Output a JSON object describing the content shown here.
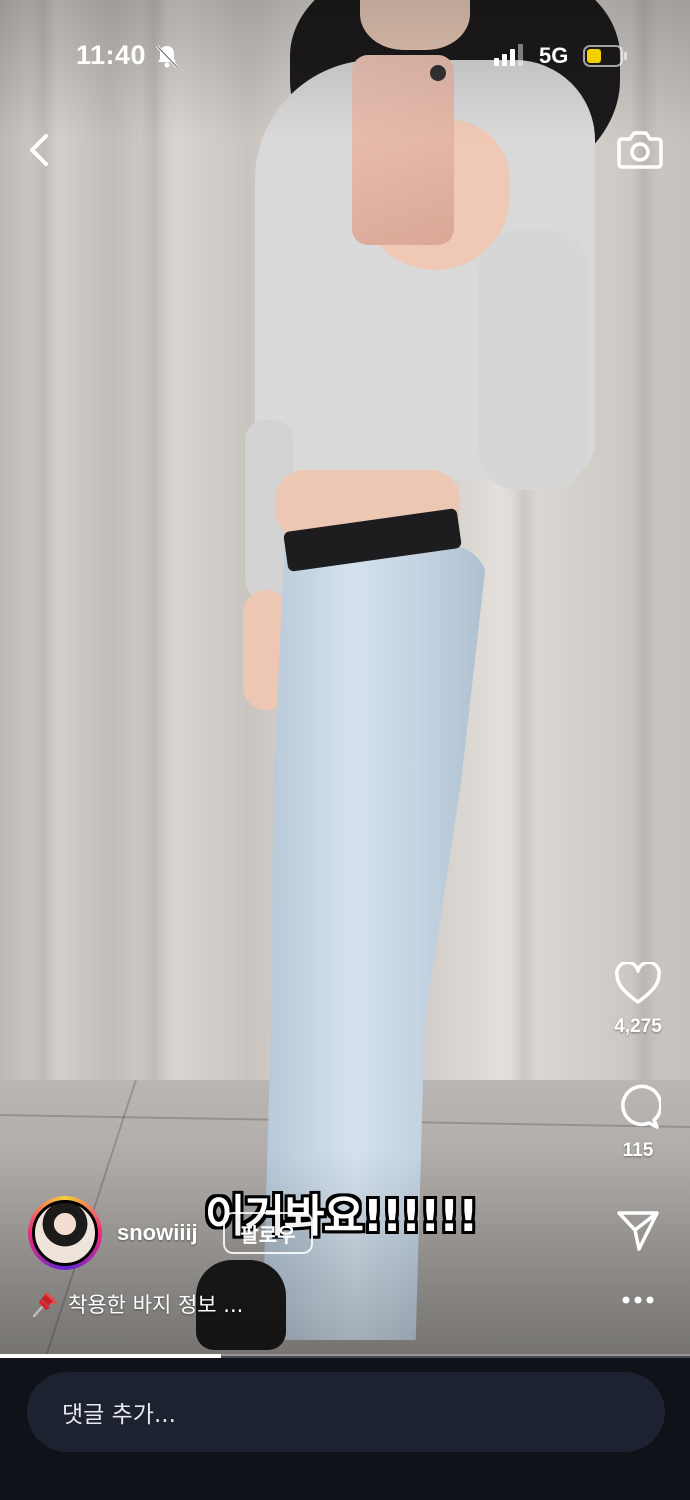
{
  "status_bar": {
    "time": "11:40",
    "network": "5G",
    "icons": [
      "bell-off-icon",
      "signal-icon",
      "battery-icon"
    ],
    "battery_color": "#f5d000"
  },
  "top_bar": {
    "back_icon": "chevron-left-icon",
    "camera_icon": "camera-icon"
  },
  "actions": {
    "like_count": "4,275",
    "comment_count": "115",
    "icons": [
      "heart-icon",
      "comment-icon",
      "share-icon",
      "more-icon"
    ]
  },
  "overlay_text": "이거봐요!!!!!!",
  "profile": {
    "username": "snowiiij",
    "follow_label": "팔로우"
  },
  "caption": {
    "icon": "pushpin-icon",
    "text": "착용한 바지 정보 ..."
  },
  "progress": {
    "fraction": 0.32
  },
  "comment_box": {
    "placeholder": "댓글 추가..."
  }
}
